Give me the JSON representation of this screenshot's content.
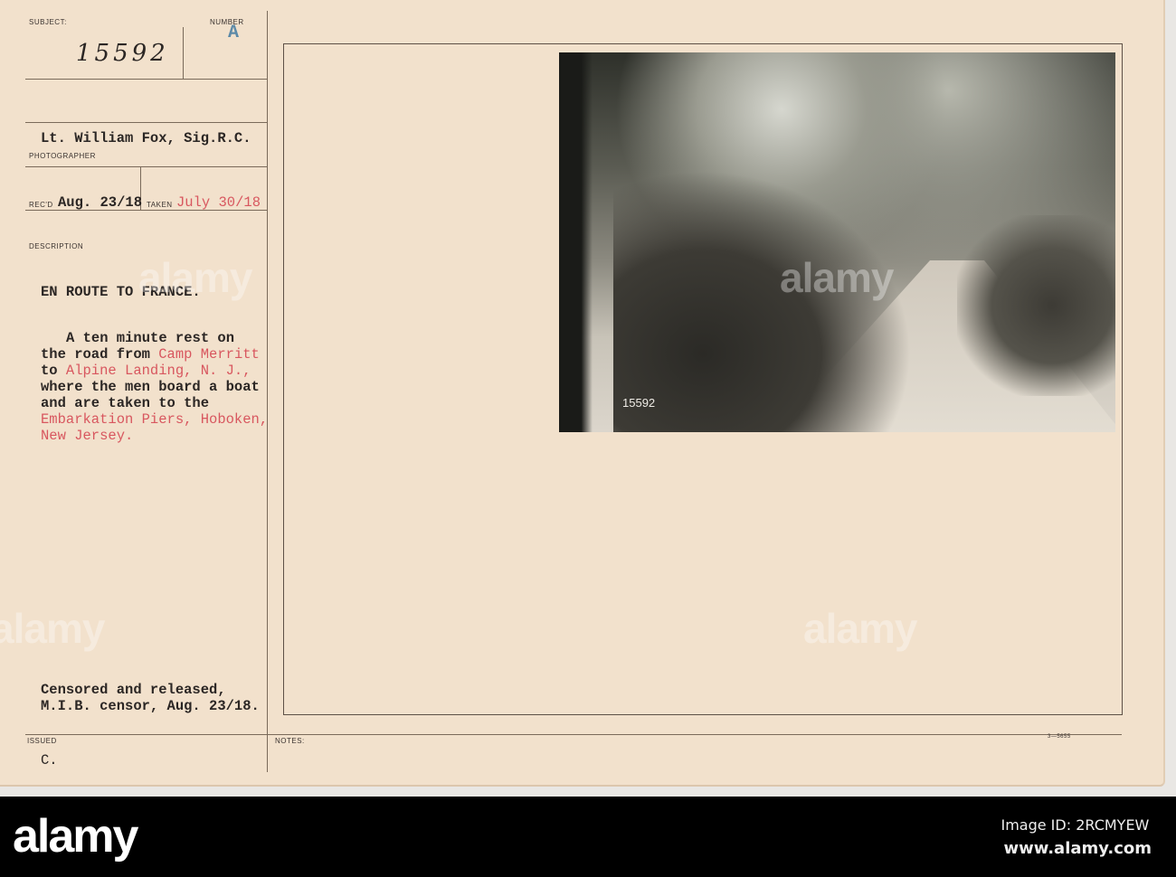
{
  "card": {
    "subject_label": "SUBJECT:",
    "subject_number": "15592",
    "number_label": "NUMBER",
    "number_value": "A",
    "photographer_name": "Lt. William Fox, Sig.R.C.",
    "photographer_label": "PHOTOGRAPHER",
    "recd_label": "REC'D",
    "recd_date": "Aug. 23/18",
    "taken_label": "TAKEN",
    "taken_date": "July 30/18",
    "description_label": "DESCRIPTION",
    "title": "EN ROUTE TO FRANCE.",
    "desc": {
      "l1": "A ten minute rest on",
      "l2a": "the road from ",
      "l2b": "Camp Merritt",
      "l3a": "to ",
      "l3b": "Alpine Landing, N. J.,",
      "l4": "where the men board a boat",
      "l5": "and are taken to the",
      "l6": "Embarkation Piers, Hoboken,",
      "l7": "New Jersey."
    },
    "censor_1": "Censored and released,",
    "censor_2": "M.I.B. censor, Aug. 23/18.",
    "issued_label": "ISSUED",
    "issued_value": "C.",
    "notes_label": "NOTES:",
    "form_number": "3—5655",
    "photo_stamp": "15592"
  },
  "watermark": "alamy",
  "footer": {
    "logo": "alamy",
    "image_id": "Image ID: 2RCMYEW",
    "url": "www.alamy.com"
  },
  "colors": {
    "card": "#f2e1cc",
    "red_type": "#d8575f",
    "footer": "#000000"
  }
}
